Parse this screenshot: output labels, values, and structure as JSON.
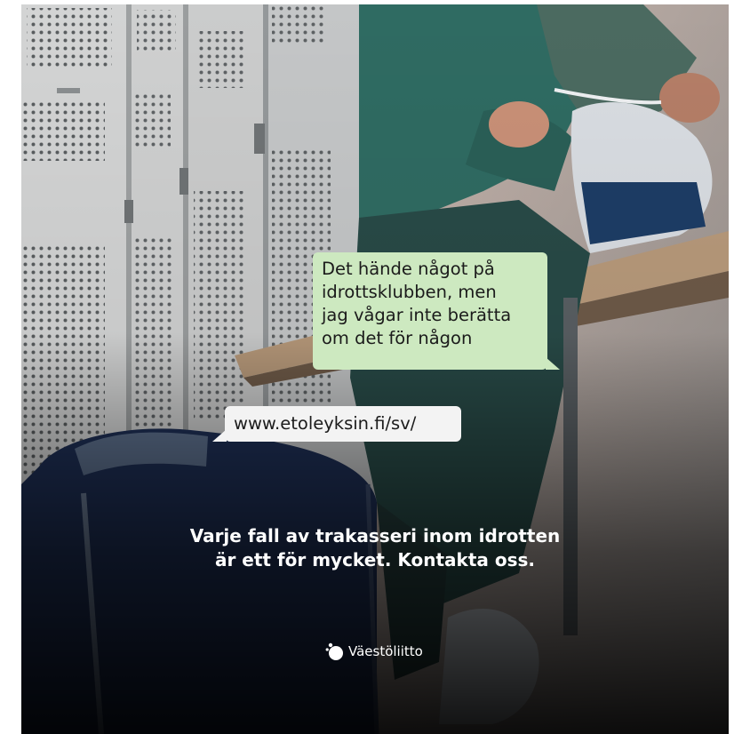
{
  "chat": {
    "message_lines": [
      "Det hände något på",
      "idrottsklubben, men",
      "jag vågar inte berätta",
      "om det för någon"
    ],
    "url": "www.etoleyksin.fi/sv/"
  },
  "headline": {
    "line1": "Varje fall av trakasseri inom idrotten",
    "line2": "är ett för mycket. Kontakta oss."
  },
  "brand": {
    "name": "Väestöliitto"
  },
  "colors": {
    "message_bubble": "#cde9c0",
    "url_bubble": "#f3f3f3",
    "text_overlay": "#ffffff"
  }
}
